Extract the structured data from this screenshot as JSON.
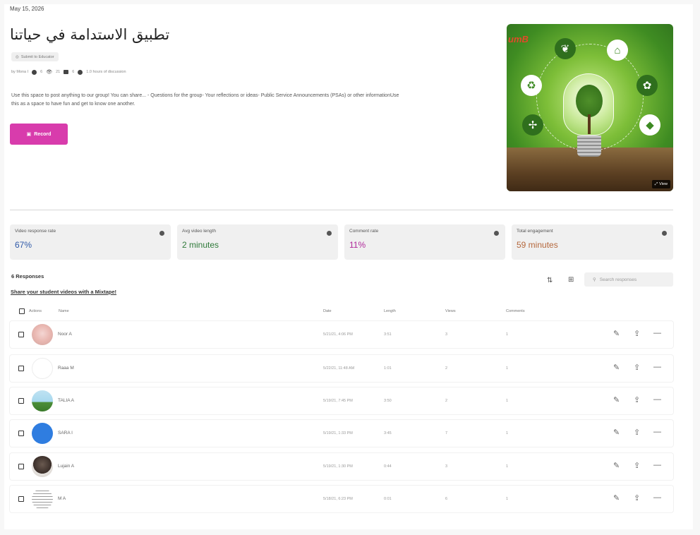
{
  "header": {
    "date": "May 15, 2026",
    "title": "تطبيق الاستدامة في حياتنا",
    "badge": "Submit to Educator",
    "meta": {
      "author": "by Mona I",
      "responses": "6",
      "views": "21",
      "comments": "6",
      "time": "1.0 hours of discussion"
    },
    "description": "Use this space to post anything to our group! You can share... - Questions for the group- Your reflections or ideas- Public Service Announcements (PSAs) or other informationUse this as a space to have fun and get to know one another.",
    "record_label": "Record"
  },
  "hero": {
    "logo_text": "umB",
    "view_label": "View"
  },
  "stats": [
    {
      "label": "Video response rate",
      "value": "67%",
      "color": "#2f59a8"
    },
    {
      "label": "Avg video length",
      "value": "2 minutes",
      "color": "#2f7a3a"
    },
    {
      "label": "Comment rate",
      "value": "11%",
      "color": "#b0299a"
    },
    {
      "label": "Total engagement",
      "value": "59 minutes",
      "color": "#b5683d"
    }
  ],
  "responses": {
    "count_label": "6 Responses",
    "share_label": "Share your student videos with a Mixtape!",
    "search_placeholder": "Search responses",
    "columns": {
      "actions": "Actions",
      "name": "Name",
      "date": "Date",
      "length": "Length",
      "views": "Views",
      "comments": "Comments"
    },
    "rows": [
      {
        "name": "Noor A",
        "date": "5/21/21, 4:06 PM",
        "length": "3:51",
        "views": "3",
        "comments": "1"
      },
      {
        "name": "Raaa M",
        "date": "5/22/21, 11:48 AM",
        "length": "1:01",
        "views": "2",
        "comments": "1"
      },
      {
        "name": "TALIA A",
        "date": "5/19/21, 7:45 PM",
        "length": "3:50",
        "views": "2",
        "comments": "1"
      },
      {
        "name": "SARA I",
        "date": "5/19/21, 1:33 PM",
        "length": "3:45",
        "views": "7",
        "comments": "1"
      },
      {
        "name": "Lujain A",
        "date": "5/19/21, 1:30 PM",
        "length": "0:44",
        "views": "3",
        "comments": "1"
      },
      {
        "name": "M A",
        "date": "5/18/21, 6:23 PM",
        "length": "0:01",
        "views": "6",
        "comments": "1"
      }
    ]
  },
  "icons": {
    "edit": "pencil-icon",
    "export": "share-icon",
    "more": "more-icon"
  }
}
